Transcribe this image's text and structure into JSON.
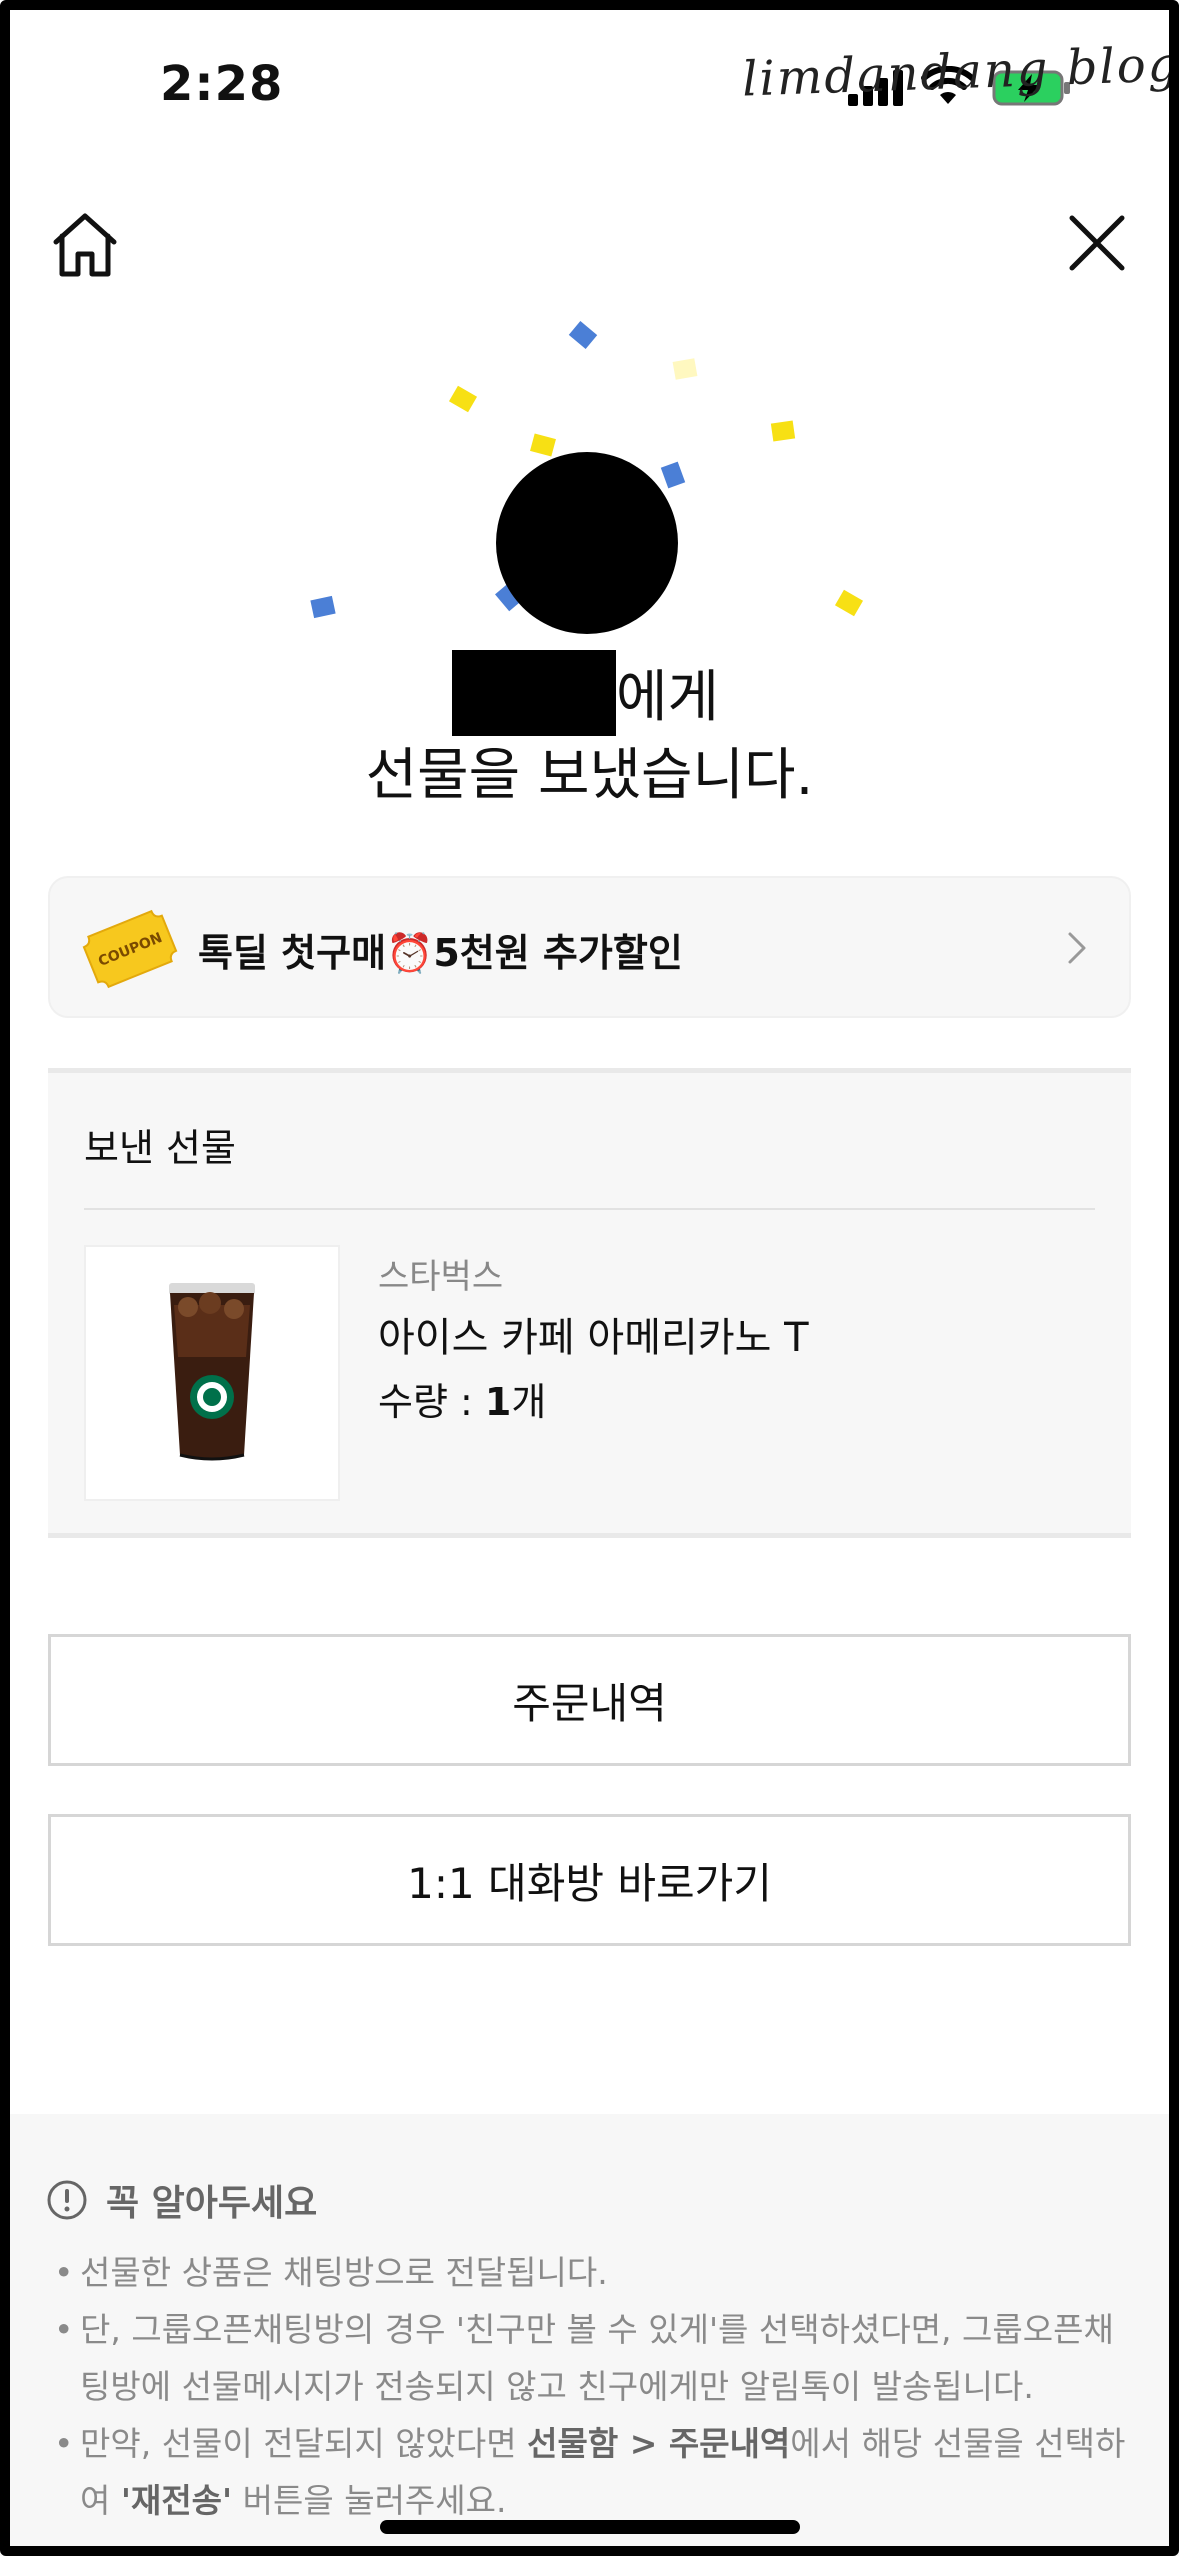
{
  "status_bar": {
    "time": "2:28",
    "watermark": "limdandang blog"
  },
  "hero": {
    "recipient_suffix": "에게",
    "message": "선물을 보냈습니다."
  },
  "promo": {
    "coupon_text": "COUPON",
    "text": "톡딜 첫구매⏰5천원 추가할인"
  },
  "gift": {
    "section_title": "보낸 선물",
    "brand": "스타벅스",
    "name": "아이스 카페 아메리카노 T",
    "qty_label": "수량 : ",
    "qty_value": "1",
    "qty_unit": "개"
  },
  "buttons": {
    "order_history": "주문내역",
    "chat_shortcut": "1:1 대화방 바로가기"
  },
  "notice": {
    "title": "꼭 알아두세요",
    "item1": "선물한 상품은 채팅방으로 전달됩니다.",
    "item2": "단, 그룹오픈채팅방의 경우 '친구만 볼 수 있게'를 선택하셨다면, 그룹오픈채팅방에 선물메시지가 전송되지 않고 친구에게만 알림톡이 발송됩니다.",
    "item3_a": "만약, 선물이 전달되지 않았다면 ",
    "item3_b": "선물함 > 주문내역",
    "item3_c": "에서 해당 선물을 선택하여 ",
    "item3_d": "'재전송'",
    "item3_e": " 버튼을 눌러주세요."
  },
  "colors": {
    "confetti_yellow": "#f7e014",
    "confetti_blue": "#4b7fd6",
    "card_bg": "#f7f7f7",
    "button_border": "#d6d6d6"
  },
  "icons": {
    "home": "home-icon",
    "close": "close-icon",
    "coupon": "coupon-icon",
    "chevron": "chevron-right-icon",
    "info": "info-icon"
  }
}
